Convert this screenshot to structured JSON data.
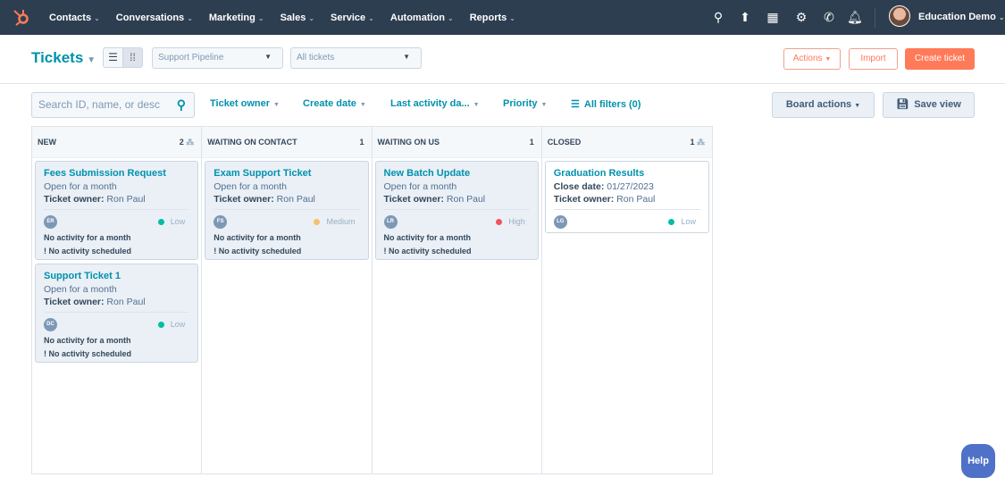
{
  "nav": {
    "items": [
      "Contacts",
      "Conversations",
      "Marketing",
      "Sales",
      "Service",
      "Automation",
      "Reports"
    ],
    "account": "Education Demo"
  },
  "header": {
    "title": "Tickets",
    "pipeline": "Support Pipeline",
    "view": "All tickets",
    "actions": "Actions",
    "import": "Import",
    "create": "Create ticket"
  },
  "filters": {
    "search_placeholder": "Search ID, name, or desc",
    "owner": "Ticket owner",
    "create_date": "Create date",
    "last_activity": "Last activity da...",
    "priority": "Priority",
    "all_filters": "All filters (0)",
    "board_actions": "Board actions",
    "save_view": "Save view"
  },
  "columns": [
    {
      "name": "NEW",
      "count": "2",
      "cards": [
        {
          "title": "Fees Submission Request",
          "line1": "Open for a month",
          "owner_label": "Ticket owner:",
          "owner": "Ron Paul",
          "initials": "ER",
          "priority": "Low",
          "priority_color": "#00bda5",
          "activity": "No activity for a month",
          "scheduled": "! No activity scheduled"
        },
        {
          "title": "Support Ticket 1",
          "line1": "Open for a month",
          "owner_label": "Ticket owner:",
          "owner": "Ron Paul",
          "initials": "DC",
          "priority": "Low",
          "priority_color": "#00bda5",
          "activity": "No activity for a month",
          "scheduled": "! No activity scheduled"
        }
      ]
    },
    {
      "name": "WAITING ON CONTACT",
      "count": "1",
      "cards": [
        {
          "title": "Exam Support Ticket",
          "line1": "Open for a month",
          "owner_label": "Ticket owner:",
          "owner": "Ron Paul",
          "initials": "FS",
          "priority": "Medium",
          "priority_color": "#f5c26b",
          "activity": "No activity for a month",
          "scheduled": "! No activity scheduled"
        }
      ]
    },
    {
      "name": "WAITING ON US",
      "count": "1",
      "cards": [
        {
          "title": "New Batch Update",
          "line1": "Open for a month",
          "owner_label": "Ticket owner:",
          "owner": "Ron Paul",
          "initials": "LR",
          "priority": "High",
          "priority_color": "#f2545b",
          "activity": "No activity for a month",
          "scheduled": "! No activity scheduled"
        }
      ]
    },
    {
      "name": "CLOSED",
      "count": "1",
      "cards": [
        {
          "title": "Graduation Results",
          "close_label": "Close date:",
          "close_date": "01/27/2023",
          "owner_label": "Ticket owner:",
          "owner": "Ron Paul",
          "initials": "LG",
          "priority": "Low",
          "priority_color": "#00bda5"
        }
      ]
    }
  ],
  "help": "Help"
}
